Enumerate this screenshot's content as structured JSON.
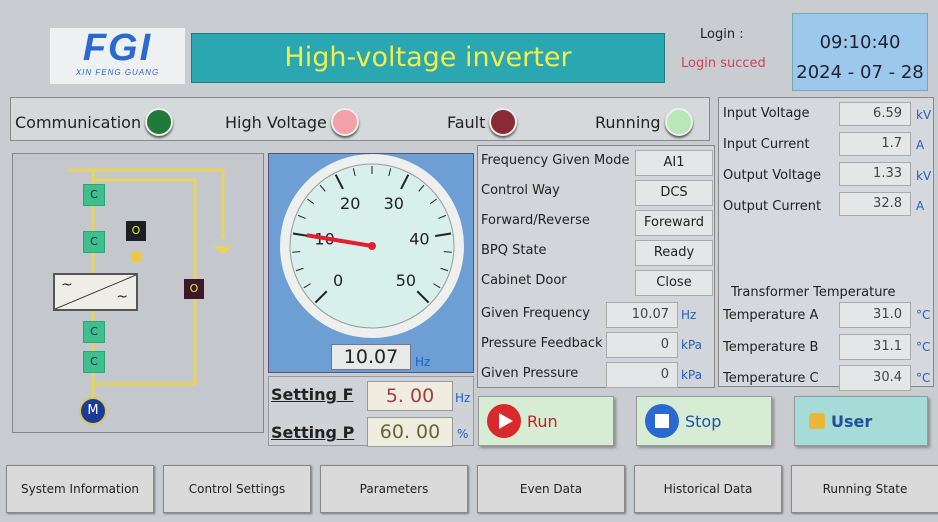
{
  "header": {
    "logo": "FGI",
    "logo_sub": "XIN FENG GUANG",
    "title": "High-voltage inverter",
    "login_label": "Login :",
    "login_status": "Login succed",
    "time": "09:10:40",
    "date": "2024 - 07 - 28"
  },
  "status": [
    {
      "label": "Communication",
      "color": "#1f7a3a"
    },
    {
      "label": "High Voltage",
      "color": "#f4a0a8"
    },
    {
      "label": "Fault",
      "color": "#8a2a36"
    },
    {
      "label": "Running",
      "color": "#b8e8b8"
    }
  ],
  "readings": [
    {
      "label": "Input Voltage",
      "value": "6.59",
      "unit": "kV"
    },
    {
      "label": "Input Current",
      "value": "1.7",
      "unit": "A"
    },
    {
      "label": "Output Voltage",
      "value": "1.33",
      "unit": "kV"
    },
    {
      "label": "Output Current",
      "value": "32.8",
      "unit": "A"
    }
  ],
  "transformer": {
    "title": "Transformer Temperature",
    "items": [
      {
        "label": "Temperature A",
        "value": "31.0",
        "unit": "°C"
      },
      {
        "label": "Temperature B",
        "value": "31.1",
        "unit": "°C"
      },
      {
        "label": "Temperature C",
        "value": "30.4",
        "unit": "°C"
      }
    ]
  },
  "info": [
    {
      "label": "Frequency Given Mode",
      "value": "AI1"
    },
    {
      "label": "Control Way",
      "value": "DCS"
    },
    {
      "label": "Forward/Reverse",
      "value": "Foreward"
    },
    {
      "label": "BPQ State",
      "value": "Ready"
    },
    {
      "label": "Cabinet Door",
      "value": "Close"
    }
  ],
  "info_values": [
    {
      "label": "Given Frequency",
      "value": "10.07",
      "unit": "Hz"
    },
    {
      "label": "Pressure Feedback",
      "value": "0",
      "unit": "kPa"
    },
    {
      "label": "Given Pressure",
      "value": "0",
      "unit": "kPa"
    }
  ],
  "diagram": {
    "switch_labels": [
      "C",
      "C",
      "C",
      "C"
    ],
    "breaker_labels": [
      "O",
      "O"
    ],
    "converter_in": "~",
    "converter_out": "~",
    "motor": "M"
  },
  "gauge": {
    "value": 10.07,
    "min": 0,
    "max": 50,
    "tick_labels": [
      "0",
      "10",
      "20",
      "30",
      "40",
      "50"
    ],
    "display": "10.07",
    "unit": "Hz"
  },
  "settings": [
    {
      "label": "Setting F",
      "value": "5. 00",
      "unit": "Hz"
    },
    {
      "label": "Setting P",
      "value": "60. 00",
      "unit": "%"
    }
  ],
  "buttons": {
    "run": "Run",
    "stop": "Stop",
    "user": "User"
  },
  "nav": [
    "System Information",
    "Control Settings",
    "Parameters",
    "Even Data",
    "Historical Data",
    "Running State"
  ]
}
